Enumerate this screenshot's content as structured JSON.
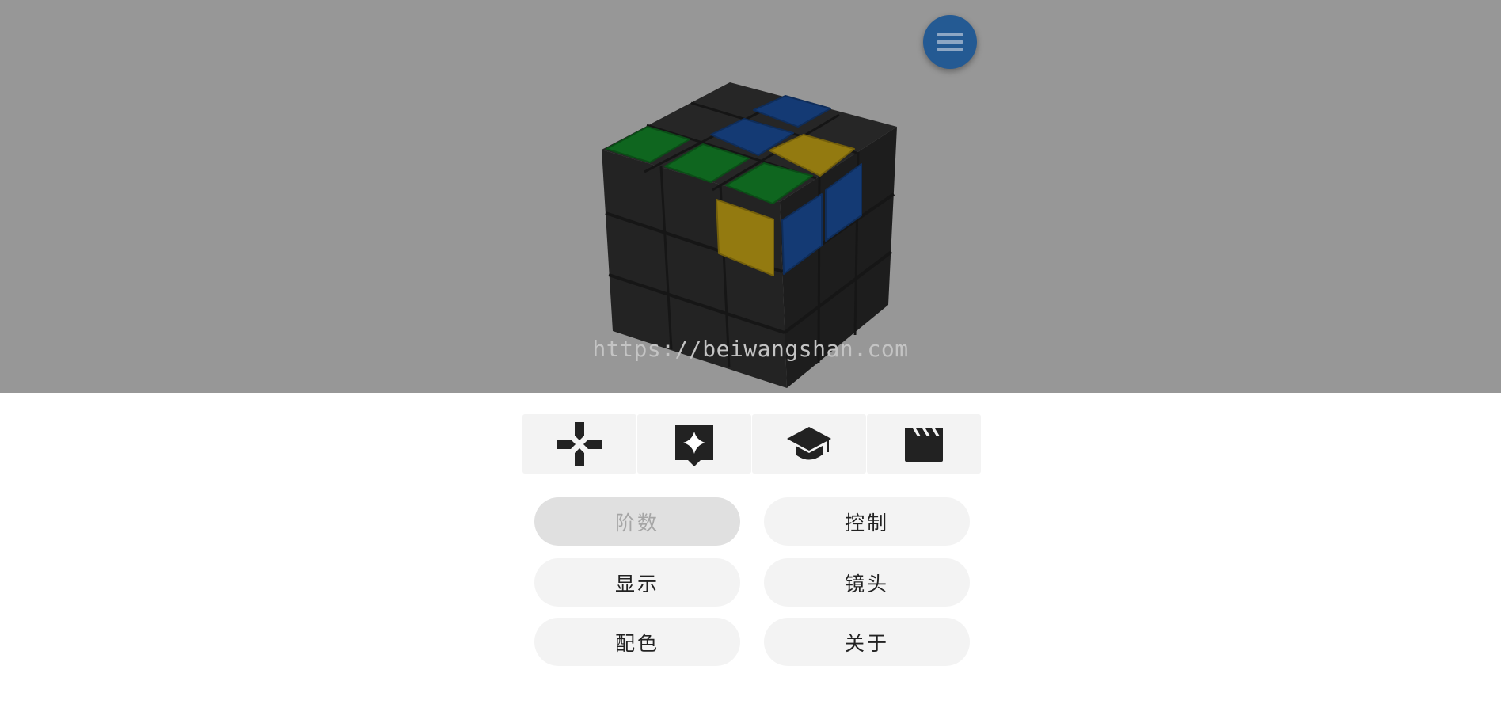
{
  "watermark": "https://beiwangshan.com",
  "tabs": [
    {
      "icon": "gamepad-icon"
    },
    {
      "icon": "sparkle-chat-icon"
    },
    {
      "icon": "graduation-cap-icon"
    },
    {
      "icon": "clapperboard-icon"
    }
  ],
  "options": {
    "order": "阶数",
    "control": "控制",
    "display": "显示",
    "camera": "镜头",
    "colors": "配色",
    "about": "关于"
  },
  "colors": {
    "stage_bg": "#979797",
    "menu_button": "#245a93",
    "cube_body": "#222222",
    "sticker_green": "#0f661f",
    "sticker_blue": "#143a74",
    "sticker_yellow": "#937a10"
  }
}
